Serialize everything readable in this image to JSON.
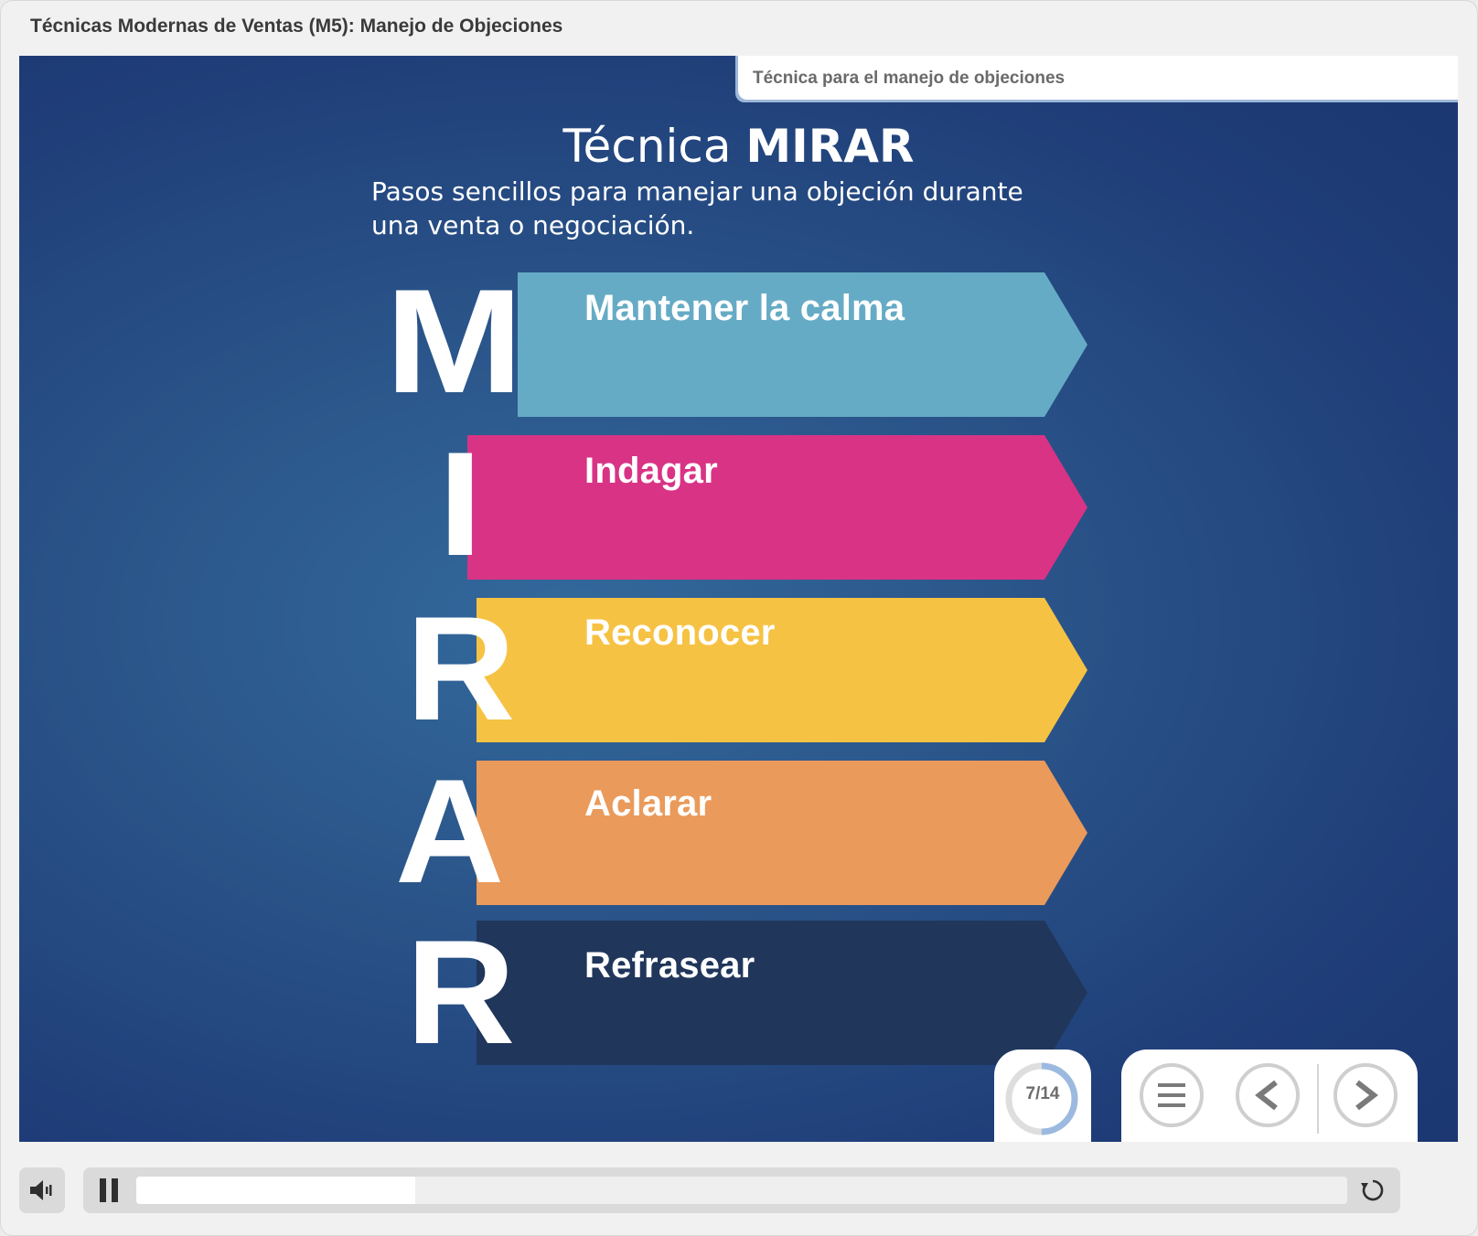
{
  "course": {
    "title": "Técnicas Modernas de Ventas (M5): Manejo de Objeciones"
  },
  "section": {
    "label": "Técnica para el manejo de objeciones"
  },
  "slide": {
    "title_regular": "Técnica ",
    "title_bold": "MIRAR",
    "subtitle": "Pasos sencillos para manejar una objeción durante una venta o negociación."
  },
  "steps": [
    {
      "letter": "M",
      "label": "Mantener la calma",
      "color": "#66abc5"
    },
    {
      "letter": "I",
      "label": "Indagar",
      "color": "#d93386"
    },
    {
      "letter": "R",
      "label": "Reconocer",
      "color": "#f6c243"
    },
    {
      "letter": "A",
      "label": "Aclarar",
      "color": "#ea9a5a"
    },
    {
      "letter": "R",
      "label": "Refrasear",
      "color": "#20365b"
    }
  ],
  "progress": {
    "counter": "7/14",
    "fraction": 0.5,
    "accent": "#9cb9e0"
  },
  "nav": {
    "menu_icon": "menu-icon",
    "prev_icon": "chevron-left-icon",
    "next_icon": "chevron-right-icon"
  },
  "player": {
    "volume_icon": "speaker-icon",
    "pause_icon": "pause-icon",
    "replay_icon": "replay-icon",
    "playback_fraction": 0.23
  }
}
